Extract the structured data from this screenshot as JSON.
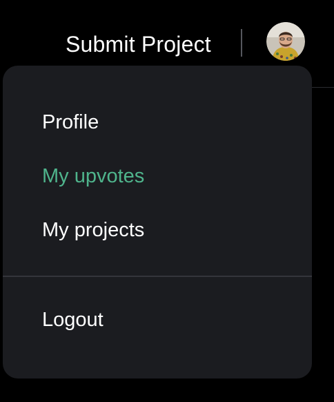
{
  "header": {
    "submit_label": "Submit Project",
    "avatar_icon": "user-avatar"
  },
  "menu": {
    "items": [
      {
        "label": "Profile",
        "active": false
      },
      {
        "label": "My upvotes",
        "active": true
      },
      {
        "label": "My projects",
        "active": false
      }
    ],
    "logout_label": "Logout"
  },
  "colors": {
    "background": "#000000",
    "menu_background": "#1b1c20",
    "active_text": "#4fb48c",
    "text": "#ffffff",
    "separator": "#34353b"
  }
}
